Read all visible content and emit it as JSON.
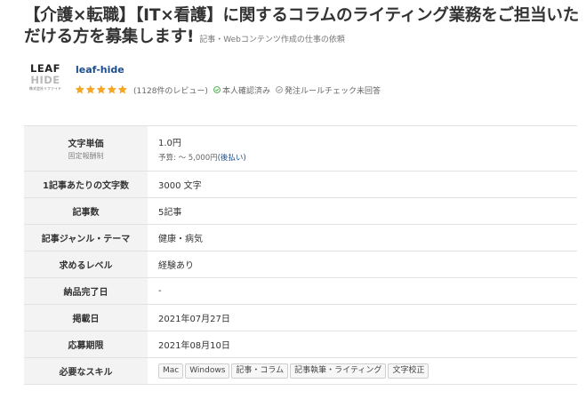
{
  "job": {
    "title": "【介護×転職】【IT×看護】に関するコラムのライティング業務をご担当いただける方を募集します!",
    "category": "記事・Webコンテンツ作成の仕事の依頼"
  },
  "client": {
    "logo_line1": "LEAF",
    "logo_line2": "HIDE",
    "logo_line3": "株式会社リファイド",
    "name": "leaf-hide",
    "rating": 5,
    "reviews": "(1128件のレビュー)",
    "identity_verified": "本人確認済み",
    "rule_check": "発注ルールチェック未回答",
    "star_color": "#f5a623"
  },
  "details": {
    "unit_price_label": "文字単価",
    "unit_price_sub": "固定報酬制",
    "unit_price_value": "1.0円",
    "budget_prefix": "予算: 〜 5,000円",
    "budget_link": "(後払い)",
    "chars_label": "1記事あたりの文字数",
    "chars_value": "3000 文字",
    "articles_label": "記事数",
    "articles_value": "5記事",
    "genre_label": "記事ジャンル・テーマ",
    "genre_value": "健康・病気",
    "level_label": "求めるレベル",
    "level_value": "経験あり",
    "delivery_label": "納品完了日",
    "delivery_value": "-",
    "posted_label": "掲載日",
    "posted_value": "2021年07月27日",
    "deadline_label": "応募期限",
    "deadline_value": "2021年08月10日",
    "skills_label": "必要なスキル",
    "skills": [
      "Mac",
      "Windows",
      "記事・コラム",
      "記事執筆・ライティング",
      "文字校正"
    ]
  }
}
